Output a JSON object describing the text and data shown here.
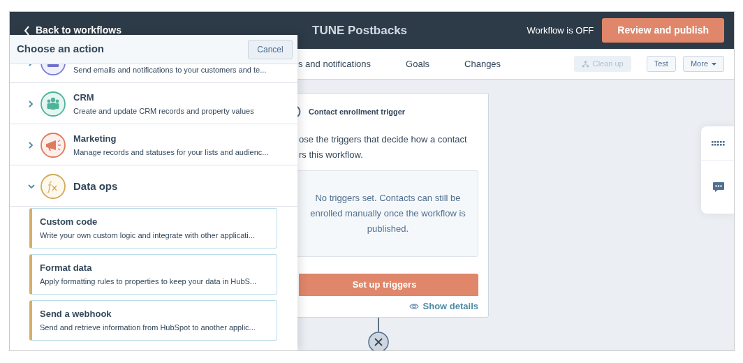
{
  "header": {
    "back_link": "Back to workflows",
    "title": "TUNE Postbacks",
    "status": "Workflow is OFF",
    "publish_button": "Review and publish"
  },
  "tabs": [
    {
      "label": "s and notifications"
    },
    {
      "label": "Goals"
    },
    {
      "label": "Changes"
    }
  ],
  "toolbar": [
    {
      "label": "Clean up",
      "disabled": true,
      "kind": "cleanup"
    },
    {
      "label": "Test",
      "disabled": false,
      "kind": "plain"
    },
    {
      "label": "More",
      "disabled": false,
      "kind": "dropdown"
    }
  ],
  "trigger_card": {
    "title": "Contact enrollment trigger",
    "description": "ose the triggers that decide how a contact\nrs this workflow.",
    "empty_message": "No triggers set. Contacts can still be enrolled manually once the workflow is published.",
    "button": "Set up triggers",
    "details_link": "Show details"
  },
  "action_panel": {
    "title": "Choose an action",
    "cancel_button": "Cancel",
    "categories": [
      {
        "kind": "communication",
        "description": "Send emails and notifications to your customers and te...",
        "expanded": false
      },
      {
        "kind": "crm",
        "title": "CRM",
        "description": "Create and update CRM records and property values",
        "expanded": false
      },
      {
        "kind": "marketing",
        "title": "Marketing",
        "description": "Manage records and statuses for your lists and audienc...",
        "expanded": false
      },
      {
        "kind": "data_ops",
        "title": "Data ops",
        "expanded": true,
        "actions": [
          {
            "title": "Custom code",
            "description": "Write your own custom logic and integrate with other applicati..."
          },
          {
            "title": "Format data",
            "description": "Apply formatting rules to properties to keep your data in HubS..."
          },
          {
            "title": "Send a webhook",
            "description": "Send and retrieve information from HubSpot to another applic..."
          }
        ]
      }
    ]
  }
}
